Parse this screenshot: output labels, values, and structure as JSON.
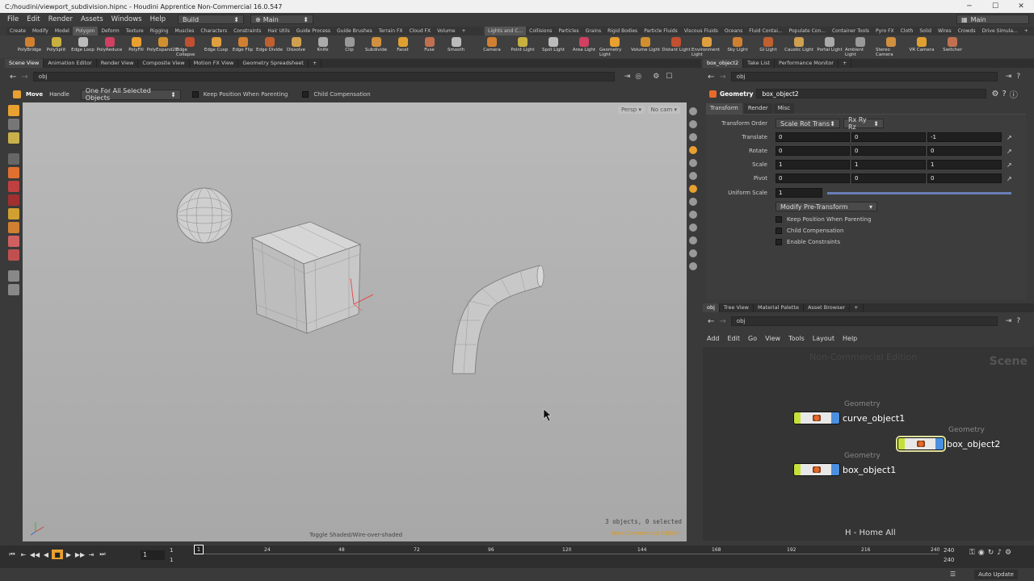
{
  "window": {
    "title": "C:/houdini/viewport_subdivision.hipnc - Houdini Apprentice Non-Commercial 16.0.547",
    "minimize": "─",
    "maximize": "☐",
    "close": "✕"
  },
  "menu": {
    "items": [
      "File",
      "Edit",
      "Render",
      "Assets",
      "Windows",
      "Help"
    ],
    "desktop": "Build",
    "context": "Main",
    "right_desktop": "Main"
  },
  "shelf_tabs_left": [
    "Create",
    "Modify",
    "Model",
    "Polygon",
    "Deform",
    "Texture",
    "Rigging",
    "Muscles",
    "Characters",
    "Constraints",
    "Hair Utils",
    "Guide Process",
    "Guide Brushes",
    "Terrain FX",
    "Cloud FX",
    "Volume"
  ],
  "shelf_tabs_right": [
    "Lights and C...",
    "Collisions",
    "Particles",
    "Grains",
    "Rigid Bodies",
    "Particle Fluids",
    "Viscous Fluids",
    "Oceans",
    "Fluid Contai...",
    "Populate Con...",
    "Container Tools",
    "Pyro FX",
    "Cloth",
    "Solid",
    "Wires",
    "Crowds",
    "Drive Simula..."
  ],
  "shelf_tools_left": [
    "PolyBridge",
    "PolySplit",
    "Edge Loop",
    "PolyReduce",
    "PolyFill",
    "PolyExpand2D",
    "Edge Collapse",
    "Edge Cusp",
    "Edge Flip",
    "Edge Divide",
    "Dissolve",
    "Knife",
    "Clip",
    "Subdivide",
    "Facet",
    "Fuse",
    "Smooth"
  ],
  "shelf_tools_right": [
    "Camera",
    "Point Light",
    "Spot Light",
    "Area Light",
    "Geometry Light",
    "Volume Light",
    "Distant Light",
    "Environment Light",
    "Sky Light",
    "GI Light",
    "Caustic Light",
    "Portal Light",
    "Ambient Light",
    "Stereo Camera",
    "VR Camera",
    "Switcher"
  ],
  "left_pane_tabs": [
    "Scene View",
    "Animation Editor",
    "Render View",
    "Composite View",
    "Motion FX View",
    "Geometry Spreadsheet"
  ],
  "left_path": "obj",
  "viewport_toolbar": {
    "tool": "Move",
    "handle": "Handle",
    "mode": "One For All Selected Objects",
    "keep_pos": "Keep Position When Parenting",
    "child_comp": "Child Compensation"
  },
  "viewport": {
    "persp": "Persp ▾",
    "cam": "No cam ▾",
    "status": "3 objects, 0 selected",
    "edition": "Non-Commercial Edition",
    "hint": "Toggle Shaded/Wire-over-shaded"
  },
  "right_pane_tabs": [
    "box_object2",
    "Take List",
    "Performance Monitor"
  ],
  "right_path": "obj",
  "params": {
    "type": "Geometry",
    "name": "box_object2",
    "tabs": [
      "Transform",
      "Render",
      "Misc"
    ],
    "transform_order_label": "Transform Order",
    "transform_order": "Scale Rot Trans",
    "rot_order": "Rx Ry Rz",
    "translate_label": "Translate",
    "translate": [
      "0",
      "0",
      "-1"
    ],
    "rotate_label": "Rotate",
    "rotate": [
      "0",
      "0",
      "0"
    ],
    "scale_label": "Scale",
    "scale": [
      "1",
      "1",
      "1"
    ],
    "pivot_label": "Pivot",
    "pivot": [
      "0",
      "0",
      "0"
    ],
    "uniform_label": "Uniform Scale",
    "uniform": "1",
    "modify_btn": "Modify Pre-Transform",
    "chk1": "Keep Position When Parenting",
    "chk2": "Child Compensation",
    "chk3": "Enable Constraints"
  },
  "net_tabs": [
    "obj",
    "Tree View",
    "Material Palette",
    "Asset Browser"
  ],
  "net_path": "obj",
  "net_menu": [
    "Add",
    "Edit",
    "Go",
    "View",
    "Tools",
    "Layout",
    "Help"
  ],
  "network": {
    "watermark": "Non-Commercial Edition",
    "context": "Scene",
    "hint": "H - Home All",
    "nodes": [
      {
        "type": "Geometry",
        "name": "curve_object1"
      },
      {
        "type": "Geometry",
        "name": "box_object2"
      },
      {
        "type": "Geometry",
        "name": "box_object1"
      }
    ]
  },
  "timeline": {
    "frame": "1",
    "start": "1",
    "start2": "1",
    "end": "240",
    "end2": "240",
    "ticks": [
      "1",
      "24",
      "48",
      "72",
      "96",
      "120",
      "144",
      "168",
      "192",
      "216",
      "240"
    ]
  },
  "statusbar": {
    "auto_update": "Auto Update"
  },
  "colors": {
    "node_left": "#c6e03a",
    "node_right": "#4a8fe0",
    "accent": "#e8a030"
  }
}
